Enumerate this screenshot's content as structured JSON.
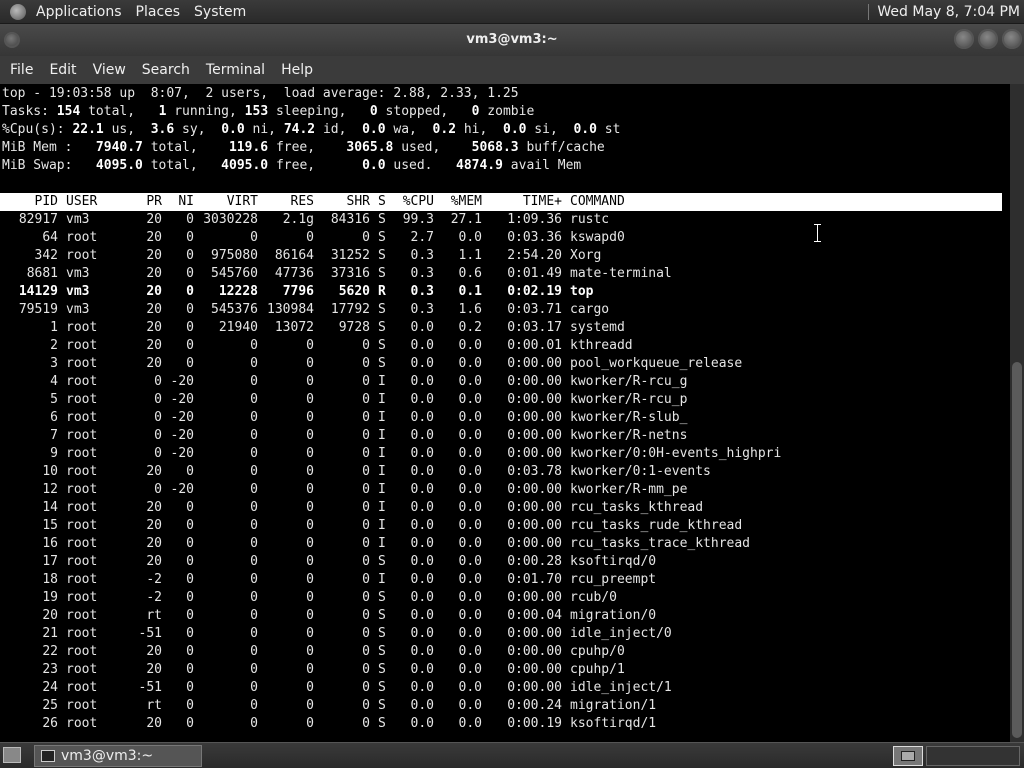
{
  "top_panel": {
    "menus": [
      "Applications",
      "Places",
      "System"
    ],
    "clock": "Wed May  8,  7:04 PM"
  },
  "window": {
    "title": "vm3@vm3:~"
  },
  "menubar": [
    "File",
    "Edit",
    "View",
    "Search",
    "Terminal",
    "Help"
  ],
  "top": {
    "summary": [
      "top - 19:03:58 up  8:07,  2 users,  load average: 2.88, 2.33, 1.25",
      [
        "Tasks: ",
        [
          "154"
        ],
        " total,   ",
        [
          "1"
        ],
        " running, ",
        [
          "153"
        ],
        " sleeping,   ",
        [
          "0"
        ],
        " stopped,   ",
        [
          "0"
        ],
        " zombie"
      ],
      [
        "%Cpu(s): ",
        [
          "22.1"
        ],
        " us,  ",
        [
          "3.6"
        ],
        " sy,  ",
        [
          "0.0"
        ],
        " ni, ",
        [
          "74.2"
        ],
        " id,  ",
        [
          "0.0"
        ],
        " wa,  ",
        [
          "0.2"
        ],
        " hi,  ",
        [
          "0.0"
        ],
        " si,  ",
        [
          "0.0"
        ],
        " st"
      ],
      [
        "MiB Mem :   ",
        [
          "7940.7"
        ],
        " total,    ",
        [
          "119.6"
        ],
        " free,    ",
        [
          "3065.8"
        ],
        " used,    ",
        [
          "5068.3"
        ],
        " buff/cache"
      ],
      [
        "MiB Swap:   ",
        [
          "4095.0"
        ],
        " total,   ",
        [
          "4095.0"
        ],
        " free,      ",
        [
          "0.0"
        ],
        " used.   ",
        [
          "4874.9"
        ],
        " avail Mem"
      ]
    ],
    "columns": [
      "PID",
      "USER",
      "PR",
      "NI",
      "VIRT",
      "RES",
      "SHR",
      "S",
      "%CPU",
      "%MEM",
      "TIME+",
      "COMMAND"
    ],
    "processes": [
      [
        "82917",
        "vm3",
        "20",
        "0",
        "3030228",
        "2.1g",
        "84316",
        "S",
        "99.3",
        "27.1",
        "1:09.36",
        "rustc"
      ],
      [
        "64",
        "root",
        "20",
        "0",
        "0",
        "0",
        "0",
        "S",
        "2.7",
        "0.0",
        "0:03.36",
        "kswapd0"
      ],
      [
        "342",
        "root",
        "20",
        "0",
        "975080",
        "86164",
        "31252",
        "S",
        "0.3",
        "1.1",
        "2:54.20",
        "Xorg"
      ],
      [
        "8681",
        "vm3",
        "20",
        "0",
        "545760",
        "47736",
        "37316",
        "S",
        "0.3",
        "0.6",
        "0:01.49",
        "mate-terminal"
      ],
      [
        "14129",
        "vm3",
        "20",
        "0",
        "12228",
        "7796",
        "5620",
        "R",
        "0.3",
        "0.1",
        "0:02.19",
        "top"
      ],
      [
        "79519",
        "vm3",
        "20",
        "0",
        "545376",
        "130984",
        "17792",
        "S",
        "0.3",
        "1.6",
        "0:03.71",
        "cargo"
      ],
      [
        "1",
        "root",
        "20",
        "0",
        "21940",
        "13072",
        "9728",
        "S",
        "0.0",
        "0.2",
        "0:03.17",
        "systemd"
      ],
      [
        "2",
        "root",
        "20",
        "0",
        "0",
        "0",
        "0",
        "S",
        "0.0",
        "0.0",
        "0:00.01",
        "kthreadd"
      ],
      [
        "3",
        "root",
        "20",
        "0",
        "0",
        "0",
        "0",
        "S",
        "0.0",
        "0.0",
        "0:00.00",
        "pool_workqueue_release"
      ],
      [
        "4",
        "root",
        "0",
        "-20",
        "0",
        "0",
        "0",
        "I",
        "0.0",
        "0.0",
        "0:00.00",
        "kworker/R-rcu_g"
      ],
      [
        "5",
        "root",
        "0",
        "-20",
        "0",
        "0",
        "0",
        "I",
        "0.0",
        "0.0",
        "0:00.00",
        "kworker/R-rcu_p"
      ],
      [
        "6",
        "root",
        "0",
        "-20",
        "0",
        "0",
        "0",
        "I",
        "0.0",
        "0.0",
        "0:00.00",
        "kworker/R-slub_"
      ],
      [
        "7",
        "root",
        "0",
        "-20",
        "0",
        "0",
        "0",
        "I",
        "0.0",
        "0.0",
        "0:00.00",
        "kworker/R-netns"
      ],
      [
        "9",
        "root",
        "0",
        "-20",
        "0",
        "0",
        "0",
        "I",
        "0.0",
        "0.0",
        "0:00.00",
        "kworker/0:0H-events_highpri"
      ],
      [
        "10",
        "root",
        "20",
        "0",
        "0",
        "0",
        "0",
        "I",
        "0.0",
        "0.0",
        "0:03.78",
        "kworker/0:1-events"
      ],
      [
        "12",
        "root",
        "0",
        "-20",
        "0",
        "0",
        "0",
        "I",
        "0.0",
        "0.0",
        "0:00.00",
        "kworker/R-mm_pe"
      ],
      [
        "14",
        "root",
        "20",
        "0",
        "0",
        "0",
        "0",
        "I",
        "0.0",
        "0.0",
        "0:00.00",
        "rcu_tasks_kthread"
      ],
      [
        "15",
        "root",
        "20",
        "0",
        "0",
        "0",
        "0",
        "I",
        "0.0",
        "0.0",
        "0:00.00",
        "rcu_tasks_rude_kthread"
      ],
      [
        "16",
        "root",
        "20",
        "0",
        "0",
        "0",
        "0",
        "I",
        "0.0",
        "0.0",
        "0:00.00",
        "rcu_tasks_trace_kthread"
      ],
      [
        "17",
        "root",
        "20",
        "0",
        "0",
        "0",
        "0",
        "S",
        "0.0",
        "0.0",
        "0:00.28",
        "ksoftirqd/0"
      ],
      [
        "18",
        "root",
        "-2",
        "0",
        "0",
        "0",
        "0",
        "I",
        "0.0",
        "0.0",
        "0:01.70",
        "rcu_preempt"
      ],
      [
        "19",
        "root",
        "-2",
        "0",
        "0",
        "0",
        "0",
        "S",
        "0.0",
        "0.0",
        "0:00.00",
        "rcub/0"
      ],
      [
        "20",
        "root",
        "rt",
        "0",
        "0",
        "0",
        "0",
        "S",
        "0.0",
        "0.0",
        "0:00.04",
        "migration/0"
      ],
      [
        "21",
        "root",
        "-51",
        "0",
        "0",
        "0",
        "0",
        "S",
        "0.0",
        "0.0",
        "0:00.00",
        "idle_inject/0"
      ],
      [
        "22",
        "root",
        "20",
        "0",
        "0",
        "0",
        "0",
        "S",
        "0.0",
        "0.0",
        "0:00.00",
        "cpuhp/0"
      ],
      [
        "23",
        "root",
        "20",
        "0",
        "0",
        "0",
        "0",
        "S",
        "0.0",
        "0.0",
        "0:00.00",
        "cpuhp/1"
      ],
      [
        "24",
        "root",
        "-51",
        "0",
        "0",
        "0",
        "0",
        "S",
        "0.0",
        "0.0",
        "0:00.00",
        "idle_inject/1"
      ],
      [
        "25",
        "root",
        "rt",
        "0",
        "0",
        "0",
        "0",
        "S",
        "0.0",
        "0.0",
        "0:00.24",
        "migration/1"
      ],
      [
        "26",
        "root",
        "20",
        "0",
        "0",
        "0",
        "0",
        "S",
        "0.0",
        "0.0",
        "0:00.19",
        "ksoftirqd/1"
      ]
    ],
    "highlighted_pid": "14129"
  },
  "taskbar": {
    "task_label": "vm3@vm3:~"
  },
  "colors": {
    "terminal_bg": "#000000",
    "terminal_fg": "#e6e6e6",
    "header_bg": "#ffffff",
    "panel_bg": "#2f2f2f"
  }
}
